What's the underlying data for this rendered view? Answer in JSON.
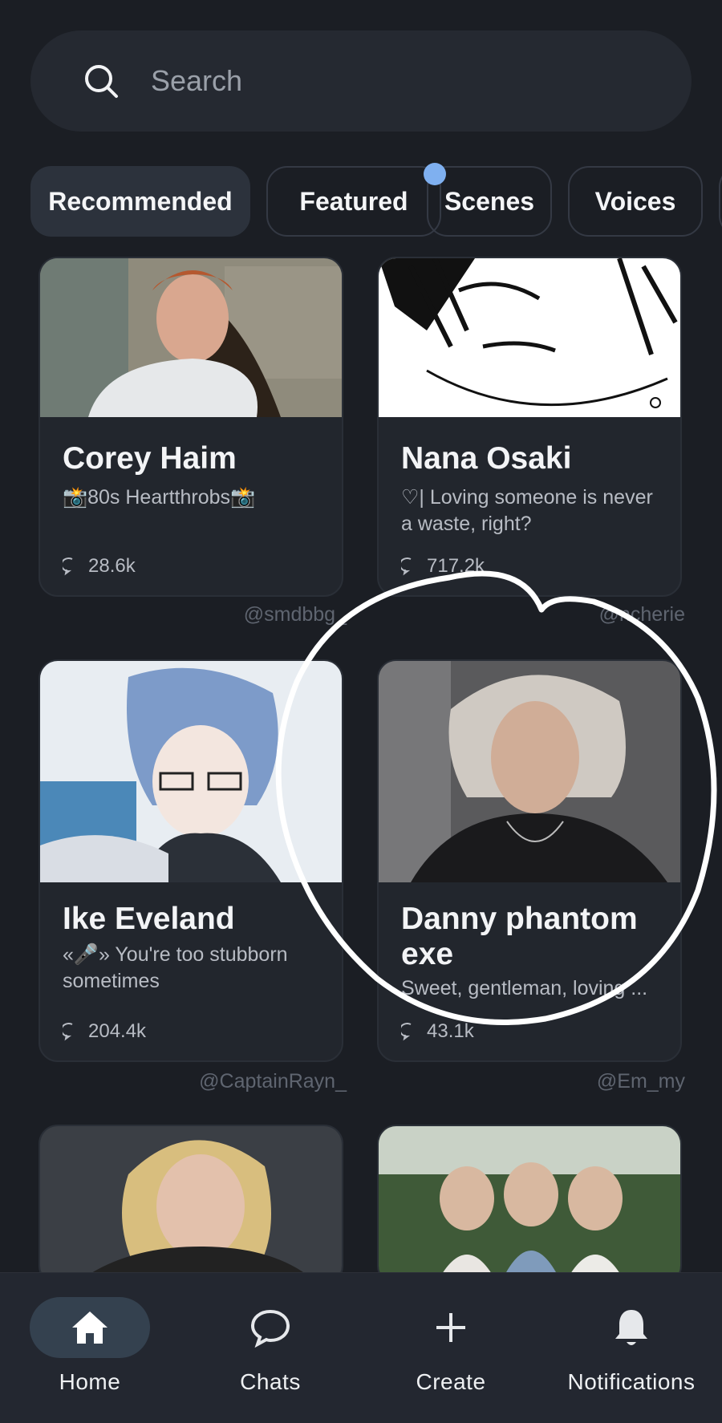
{
  "search": {
    "placeholder": "Search"
  },
  "tabs": [
    {
      "label": "Recommended",
      "active": true
    },
    {
      "label": "Featured",
      "active": false
    },
    {
      "label": "Scenes",
      "active": false
    },
    {
      "label": "Voices",
      "active": false
    }
  ],
  "cards": [
    {
      "name": "Corey Haim",
      "description": "📸80s Heartthrobs📸",
      "count": "28.6k",
      "creator": "@smdbbg_"
    },
    {
      "name": "Nana Osaki",
      "description": "♡| Loving someone is never a waste, right?",
      "count": "717.2k",
      "creator": "@ncherie"
    },
    {
      "name": "Ike Eveland",
      "description": "«🎤» You're too stubborn sometimes",
      "count": "204.4k",
      "creator": "@CaptainRayn_"
    },
    {
      "name": "Danny phantom exe",
      "description": "Sweet, gentleman, loving ...",
      "count": "43.1k",
      "creator": "@Em_my"
    }
  ],
  "nav": [
    {
      "label": "Home",
      "icon": "home-icon",
      "active": true
    },
    {
      "label": "Chats",
      "icon": "chat-bubble-icon",
      "active": false
    },
    {
      "label": "Create",
      "icon": "plus-icon",
      "active": false
    },
    {
      "label": "Notifications",
      "icon": "bell-icon",
      "active": false
    }
  ],
  "colors": {
    "background": "#1b1e24",
    "card": "#22262d",
    "accent_dot": "#7fb0f0"
  }
}
